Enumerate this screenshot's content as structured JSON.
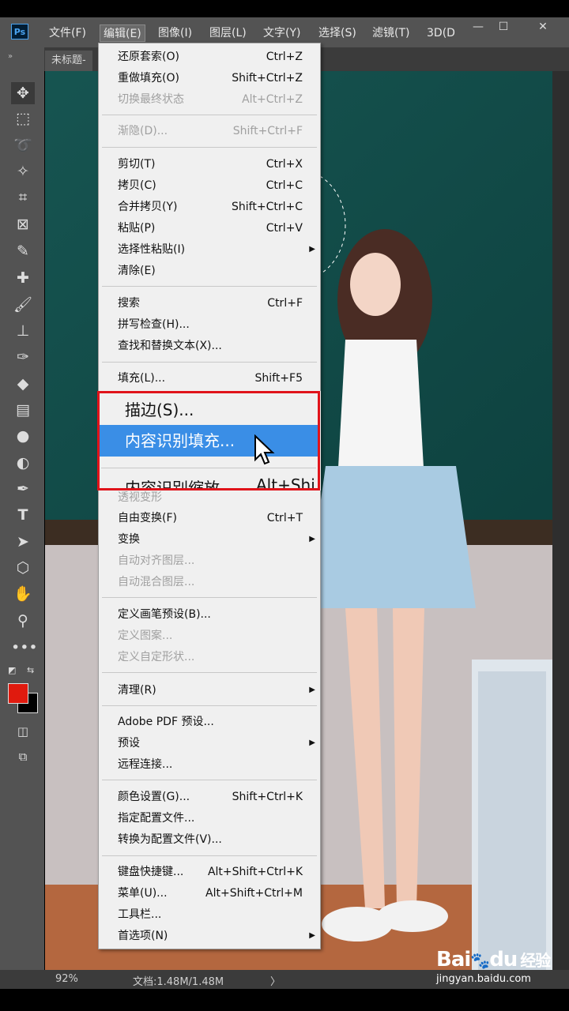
{
  "app": {
    "logo": "Ps"
  },
  "menubar": {
    "items": [
      "文件(F)",
      "编辑(E)",
      "图像(I)",
      "图层(L)",
      "文字(Y)",
      "选择(S)",
      "滤镜(T)",
      "3D(D"
    ],
    "window_buttons": [
      "—",
      "☐",
      "✕"
    ]
  },
  "tab": {
    "title": "未标题-"
  },
  "edit_menu": {
    "items": [
      {
        "label": "还原套索(O)",
        "shortcut": "Ctrl+Z",
        "disabled": false
      },
      {
        "label": "重做填充(O)",
        "shortcut": "Shift+Ctrl+Z",
        "disabled": false
      },
      {
        "label": "切换最终状态",
        "shortcut": "Alt+Ctrl+Z",
        "disabled": true
      },
      {
        "label": "渐隐(D)...",
        "shortcut": "Shift+Ctrl+F",
        "disabled": true
      },
      {
        "label": "剪切(T)",
        "shortcut": "Ctrl+X",
        "disabled": false
      },
      {
        "label": "拷贝(C)",
        "shortcut": "Ctrl+C",
        "disabled": false
      },
      {
        "label": "合并拷贝(Y)",
        "shortcut": "Shift+Ctrl+C",
        "disabled": false
      },
      {
        "label": "粘贴(P)",
        "shortcut": "Ctrl+V",
        "disabled": false
      },
      {
        "label": "选择性粘贴(I)",
        "shortcut": "",
        "disabled": false,
        "submenu": true
      },
      {
        "label": "清除(E)",
        "shortcut": "",
        "disabled": false
      },
      {
        "label": "搜索",
        "shortcut": "Ctrl+F",
        "disabled": false
      },
      {
        "label": "拼写检查(H)...",
        "shortcut": "",
        "disabled": false
      },
      {
        "label": "查找和替换文本(X)...",
        "shortcut": "",
        "disabled": false
      },
      {
        "label": "填充(L)...",
        "shortcut": "Shift+F5",
        "disabled": false
      },
      {
        "label": "描边(S)...",
        "shortcut": "",
        "disabled": false
      },
      {
        "label": "内容识别填充...",
        "shortcut": "",
        "disabled": false,
        "highlighted": true
      },
      {
        "label": "内容识别缩放",
        "shortcut": "Alt+Shi",
        "disabled": false
      },
      {
        "label": "透视变形",
        "shortcut": "",
        "disabled": true
      },
      {
        "label": "自由变换(F)",
        "shortcut": "Ctrl+T",
        "disabled": false
      },
      {
        "label": "变换",
        "shortcut": "",
        "disabled": false,
        "submenu": true
      },
      {
        "label": "自动对齐图层...",
        "shortcut": "",
        "disabled": true
      },
      {
        "label": "自动混合图层...",
        "shortcut": "",
        "disabled": true
      },
      {
        "label": "定义画笔预设(B)...",
        "shortcut": "",
        "disabled": false
      },
      {
        "label": "定义图案...",
        "shortcut": "",
        "disabled": true
      },
      {
        "label": "定义自定形状...",
        "shortcut": "",
        "disabled": true
      },
      {
        "label": "清理(R)",
        "shortcut": "",
        "disabled": false,
        "submenu": true
      },
      {
        "label": "Adobe PDF 预设...",
        "shortcut": "",
        "disabled": false
      },
      {
        "label": "预设",
        "shortcut": "",
        "disabled": false,
        "submenu": true
      },
      {
        "label": "远程连接...",
        "shortcut": "",
        "disabled": false
      },
      {
        "label": "颜色设置(G)...",
        "shortcut": "Shift+Ctrl+K",
        "disabled": false
      },
      {
        "label": "指定配置文件...",
        "shortcut": "",
        "disabled": false
      },
      {
        "label": "转换为配置文件(V)...",
        "shortcut": "",
        "disabled": false
      },
      {
        "label": "键盘快捷键...",
        "shortcut": "Alt+Shift+Ctrl+K",
        "disabled": false
      },
      {
        "label": "菜单(U)...",
        "shortcut": "Alt+Shift+Ctrl+M",
        "disabled": false
      },
      {
        "label": "工具栏...",
        "shortcut": "",
        "disabled": false
      },
      {
        "label": "首选项(N)",
        "shortcut": "",
        "disabled": false,
        "submenu": true
      }
    ]
  },
  "status": {
    "zoom": "92%",
    "doc": "文档:1.48M/1.48M",
    "arrow": "〉"
  },
  "watermark": {
    "brand": "Bai",
    "brand2": "du",
    "brand_cn": "经验",
    "url": "jingyan.baidu.com"
  },
  "colors": {
    "foreground": "#e01a0e",
    "background": "#000000",
    "highlight": "#3a8ee6",
    "frame": "#e0131a"
  }
}
